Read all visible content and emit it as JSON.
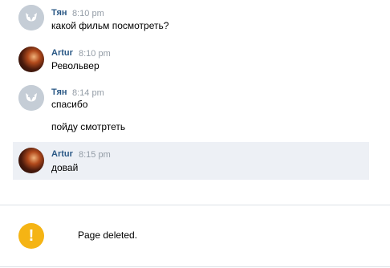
{
  "messages": [
    {
      "author": "Тян",
      "time": "8:10 pm",
      "lines": [
        "какой фильм посмотреть?"
      ]
    },
    {
      "author": "Artur",
      "time": "8:10 pm",
      "lines": [
        "Револьвер"
      ]
    },
    {
      "author": "Тян",
      "time": "8:14 pm",
      "lines": [
        "спасибо",
        "пойду смотртеть"
      ]
    },
    {
      "author": "Artur",
      "time": "8:15 pm",
      "lines": [
        "довай"
      ]
    }
  ],
  "notice": {
    "icon": "warning-icon",
    "icon_glyph": "!",
    "text": "Page deleted."
  },
  "colors": {
    "author": "#2a5885",
    "time": "#939ca6",
    "highlight": "#edf0f5",
    "warning": "#f5b414"
  }
}
